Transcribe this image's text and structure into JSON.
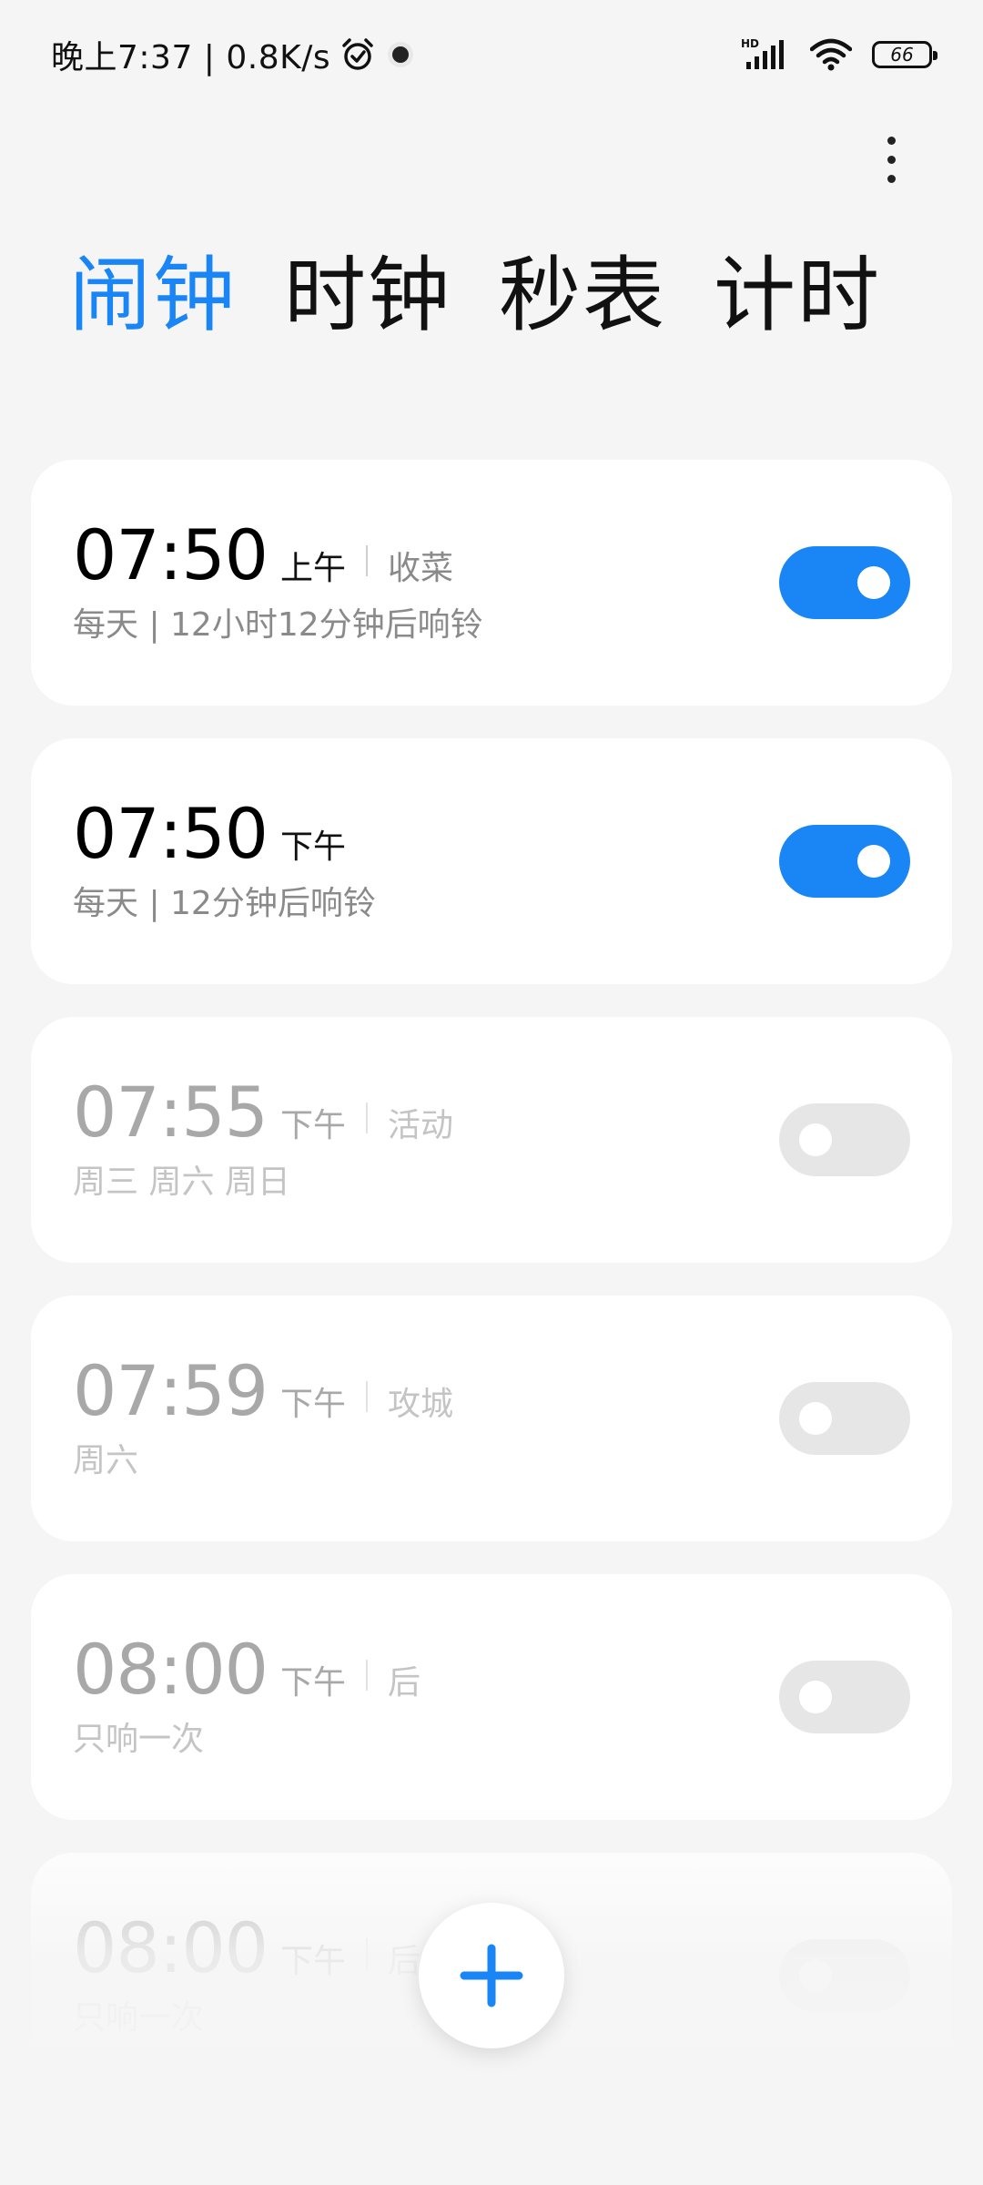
{
  "status_bar": {
    "time_speed": "晚上7:37 | 0.8K/s",
    "battery": "66",
    "icons": [
      "alarm-icon",
      "notification-dot-icon",
      "hd-signal-icon",
      "wifi-icon",
      "battery-icon"
    ]
  },
  "menu": {
    "icon": "more-vertical-icon"
  },
  "tabs": [
    {
      "label": "闹钟",
      "active": true
    },
    {
      "label": "时钟",
      "active": false
    },
    {
      "label": "秒表",
      "active": false
    },
    {
      "label": "计时",
      "active": false
    }
  ],
  "alarms": [
    {
      "time": "07:50",
      "ampm": "上午",
      "label": "收菜",
      "sub": "每天 | 12小时12分钟后响铃",
      "enabled": true
    },
    {
      "time": "07:50",
      "ampm": "下午",
      "label": "",
      "sub": "每天 | 12分钟后响铃",
      "enabled": true
    },
    {
      "time": "07:55",
      "ampm": "下午",
      "label": "活动",
      "sub": "周三 周六 周日",
      "enabled": false
    },
    {
      "time": "07:59",
      "ampm": "下午",
      "label": "攻城",
      "sub": "周六",
      "enabled": false
    },
    {
      "time": "08:00",
      "ampm": "下午",
      "label": "后",
      "sub": "只响一次",
      "enabled": false
    },
    {
      "time": "08:00",
      "ampm": "下午",
      "label": "后",
      "sub": "只响一次",
      "enabled": false
    }
  ],
  "fab": {
    "icon": "plus-icon"
  },
  "colors": {
    "accent": "#1a86f5",
    "background": "#f5f5f5",
    "card": "#ffffff",
    "toggle_off": "#e6e6e6"
  }
}
